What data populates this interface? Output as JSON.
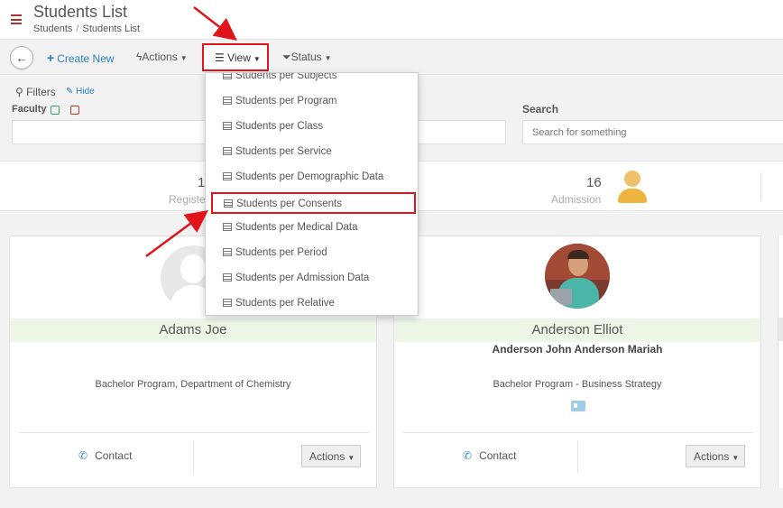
{
  "header": {
    "title": "Students List",
    "breadcrumb": [
      "Students",
      "Students List"
    ]
  },
  "toolbar": {
    "create_label": "Create New",
    "actions_label": "Actions",
    "view_label": "View",
    "status_label": "Status"
  },
  "filters": {
    "label": "Filters",
    "hide_label": "Hide",
    "faculty_label": "Faculty",
    "search_label": "Search",
    "search_placeholder": "Search for something"
  },
  "stats": {
    "left_value": "1",
    "left_label": "Registe",
    "admission_value": "16",
    "admission_label": "Admission"
  },
  "view_menu": {
    "items": [
      "Students per Subjects",
      "Students per Program",
      "Students per Class",
      "Students per Service",
      "Students per Demographic Data",
      "Students per Consents",
      "Students per Medical Data",
      "Students per Period",
      "Students per Admission Data",
      "Students per Relative"
    ],
    "highlighted": "Students per Consents"
  },
  "students": [
    {
      "name": "Adams Joe",
      "subtitle": "",
      "program": "Bachelor Program, Department of Chemistry",
      "contact_label": "Contact",
      "actions_label": "Actions"
    },
    {
      "name": "Anderson Elliot",
      "subtitle": "Anderson John Anderson Mariah",
      "program": "Bachelor Program  -  Business Strategy",
      "contact_label": "Contact",
      "actions_label": "Actions"
    }
  ],
  "colors": {
    "accent_blue": "#2a7fc7",
    "annotation_red": "#e0141a",
    "name_band": "#eef6e8",
    "admission_icon": "#f0b540"
  }
}
